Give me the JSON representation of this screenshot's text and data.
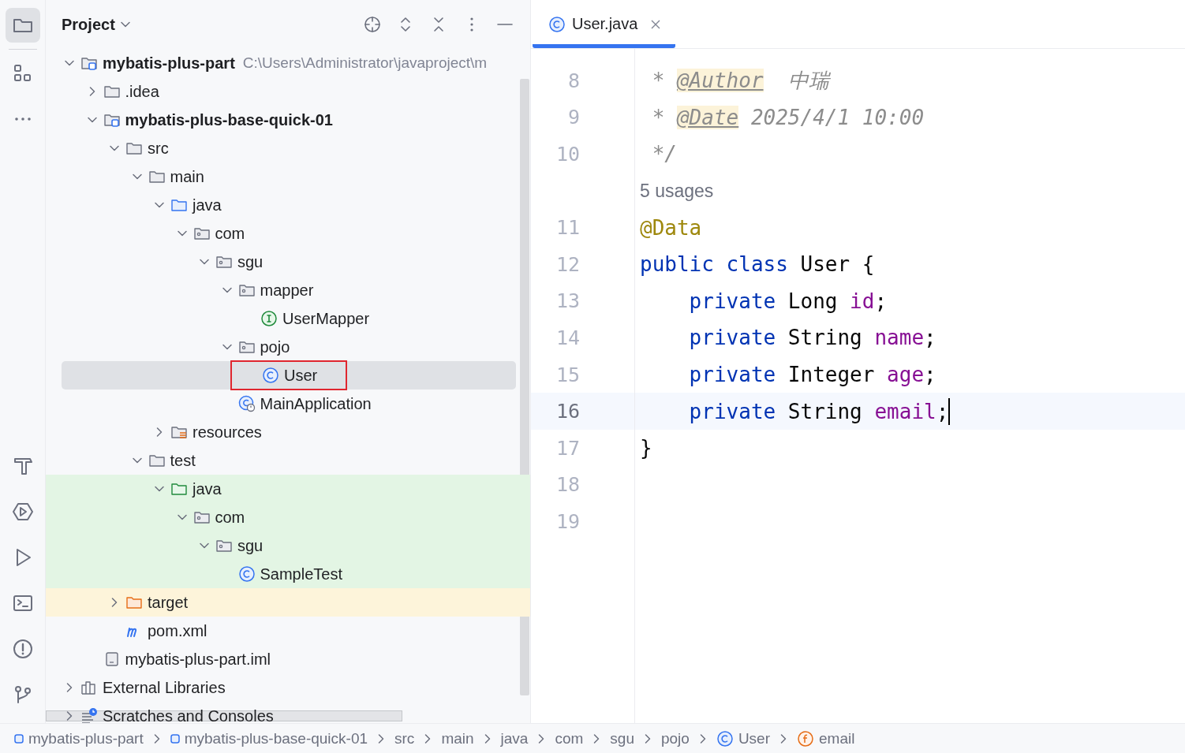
{
  "stripe": [
    {
      "kind": "project",
      "selected": true
    },
    {
      "kind": "structure",
      "selected": false
    },
    {
      "kind": "more",
      "selected": false
    },
    {
      "kind": "build",
      "selected": false
    },
    {
      "kind": "services",
      "selected": false
    },
    {
      "kind": "run",
      "selected": false
    },
    {
      "kind": "terminal",
      "selected": false
    },
    {
      "kind": "problems",
      "selected": false
    },
    {
      "kind": "git",
      "selected": false
    }
  ],
  "project_panel": {
    "title": "Project",
    "tree": [
      {
        "kind": "module",
        "label": "mybatis-plus-part",
        "hint": "C:\\Users\\Administrator\\javaproject\\m",
        "bold": true,
        "expanded": true,
        "selected": false,
        "children": [
          {
            "kind": "folder",
            "label": ".idea",
            "expanded": false,
            "selected": false
          },
          {
            "kind": "module",
            "label": "mybatis-plus-base-quick-01",
            "bold": true,
            "expanded": true,
            "selected": false,
            "children": [
              {
                "kind": "folder",
                "label": "src",
                "expanded": true,
                "selected": false,
                "children": [
                  {
                    "kind": "folder",
                    "label": "main",
                    "expanded": true,
                    "selected": false,
                    "children": [
                      {
                        "kind": "source-root",
                        "label": "java",
                        "expanded": true,
                        "selected": false,
                        "children": [
                          {
                            "kind": "package",
                            "label": "com",
                            "expanded": true,
                            "selected": false,
                            "children": [
                              {
                                "kind": "package",
                                "label": "sgu",
                                "expanded": true,
                                "selected": false,
                                "children": [
                                  {
                                    "kind": "package",
                                    "label": "mapper",
                                    "expanded": true,
                                    "selected": false,
                                    "children": [
                                      {
                                        "kind": "interface",
                                        "label": "UserMapper",
                                        "selected": false
                                      }
                                    ]
                                  },
                                  {
                                    "kind": "package",
                                    "label": "pojo",
                                    "expanded": true,
                                    "selected": false,
                                    "children": [
                                      {
                                        "kind": "class",
                                        "label": "User",
                                        "selected": true,
                                        "outlined": true
                                      }
                                    ]
                                  },
                                  {
                                    "kind": "app-class",
                                    "label": "MainApplication",
                                    "selected": false
                                  }
                                ]
                              }
                            ]
                          }
                        ]
                      },
                      {
                        "kind": "resources",
                        "label": "resources",
                        "expanded": false,
                        "selected": false
                      }
                    ]
                  },
                  {
                    "kind": "folder",
                    "label": "test",
                    "expanded": true,
                    "selected": false,
                    "children": [
                      {
                        "kind": "test-root",
                        "label": "java",
                        "expanded": true,
                        "selected": false,
                        "children": [
                          {
                            "kind": "package",
                            "label": "com",
                            "expanded": true,
                            "selected": false,
                            "children": [
                              {
                                "kind": "package",
                                "label": "sgu",
                                "expanded": true,
                                "selected": false,
                                "children": [
                                  {
                                    "kind": "class",
                                    "label": "SampleTest",
                                    "selected": false
                                  }
                                ]
                              }
                            ]
                          }
                        ]
                      }
                    ]
                  }
                ]
              },
              {
                "kind": "excluded",
                "label": "target",
                "expanded": false,
                "selected": false
              },
              {
                "kind": "maven",
                "label": "pom.xml",
                "selected": false
              }
            ]
          },
          {
            "kind": "iml",
            "label": "mybatis-plus-part.iml",
            "selected": false
          }
        ]
      },
      {
        "kind": "libraries",
        "label": "External Libraries",
        "expanded": false,
        "selected": false
      },
      {
        "kind": "scratches",
        "label": "Scratches and Consoles",
        "expanded": false,
        "selected": false
      }
    ]
  },
  "editor": {
    "tabs": [
      {
        "label": "User.java",
        "selected": true
      }
    ],
    "lines": [
      {
        "kind": "code",
        "number": "8",
        "tokens": [
          {
            "kind": "comment",
            "text": " * "
          },
          {
            "kind": "doc-tag",
            "text": "@Author"
          },
          {
            "kind": "comment",
            "text": "  中瑞"
          }
        ]
      },
      {
        "kind": "code",
        "number": "9",
        "tokens": [
          {
            "kind": "comment",
            "text": " * "
          },
          {
            "kind": "doc-tag",
            "text": "@Date"
          },
          {
            "kind": "comment",
            "text": " 2025/4/1 10:00"
          }
        ]
      },
      {
        "kind": "code",
        "number": "10",
        "tokens": [
          {
            "kind": "comment",
            "text": " */"
          }
        ]
      },
      {
        "kind": "inlay",
        "text": "5 usages"
      },
      {
        "kind": "code",
        "number": "11",
        "tokens": [
          {
            "kind": "annotation",
            "text": "@Data"
          }
        ]
      },
      {
        "kind": "code",
        "number": "12",
        "tokens": [
          {
            "kind": "keyword",
            "text": "public class"
          },
          {
            "kind": "plain",
            "text": " User {"
          }
        ]
      },
      {
        "kind": "code",
        "number": "13",
        "tokens": [
          {
            "kind": "keyword",
            "text": "    private"
          },
          {
            "kind": "plain",
            "text": " Long "
          },
          {
            "kind": "field",
            "text": "id"
          },
          {
            "kind": "plain",
            "text": ";"
          }
        ]
      },
      {
        "kind": "code",
        "number": "14",
        "tokens": [
          {
            "kind": "keyword",
            "text": "    private"
          },
          {
            "kind": "plain",
            "text": " String "
          },
          {
            "kind": "field",
            "text": "name"
          },
          {
            "kind": "plain",
            "text": ";"
          }
        ]
      },
      {
        "kind": "code",
        "number": "15",
        "tokens": [
          {
            "kind": "keyword",
            "text": "    private"
          },
          {
            "kind": "plain",
            "text": " Integer "
          },
          {
            "kind": "field",
            "text": "age"
          },
          {
            "kind": "plain",
            "text": ";"
          }
        ]
      },
      {
        "kind": "code",
        "number": "16",
        "current": true,
        "tokens": [
          {
            "kind": "keyword",
            "text": "    private"
          },
          {
            "kind": "plain",
            "text": " String "
          },
          {
            "kind": "field",
            "text": "email"
          },
          {
            "kind": "plain",
            "text": ";"
          }
        ]
      },
      {
        "kind": "code",
        "number": "17",
        "tokens": [
          {
            "kind": "plain",
            "text": "}"
          }
        ]
      },
      {
        "kind": "code",
        "number": "18"
      },
      {
        "kind": "code",
        "number": "19"
      }
    ]
  },
  "breadcrumbs": [
    {
      "kind": "module",
      "label": "mybatis-plus-part"
    },
    {
      "kind": "module",
      "label": "mybatis-plus-base-quick-01"
    },
    {
      "kind": "folder",
      "label": "src"
    },
    {
      "kind": "folder",
      "label": "main"
    },
    {
      "kind": "folder",
      "label": "java"
    },
    {
      "kind": "folder",
      "label": "com"
    },
    {
      "kind": "folder",
      "label": "sgu"
    },
    {
      "kind": "folder",
      "label": "pojo"
    },
    {
      "kind": "class",
      "label": "User"
    },
    {
      "kind": "field",
      "label": "email"
    }
  ]
}
